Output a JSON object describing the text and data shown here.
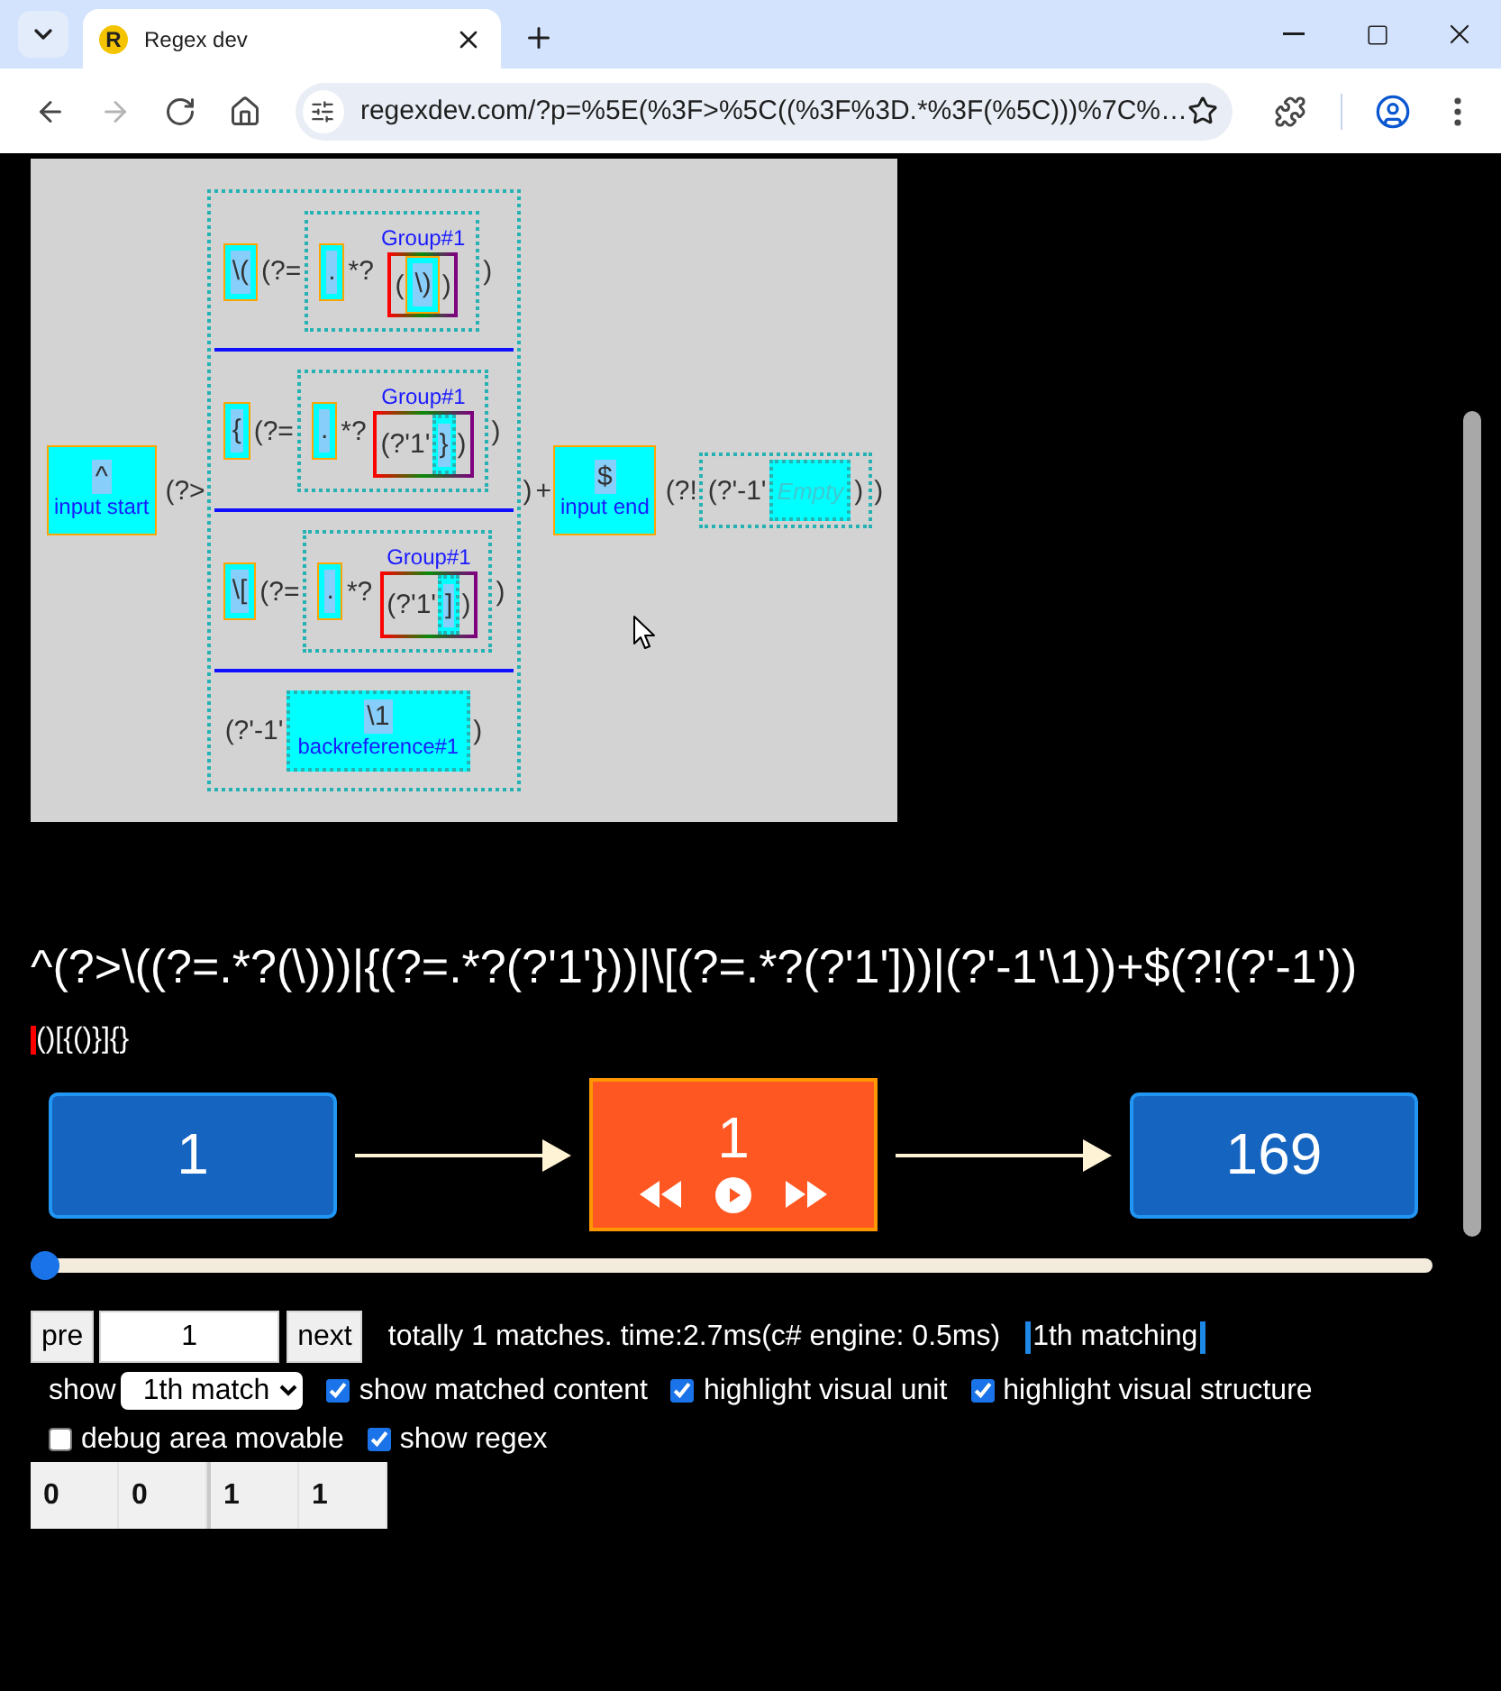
{
  "browser": {
    "tabs": [
      {
        "title": "Regex dev",
        "favicon": "R",
        "selected": true
      }
    ],
    "nav": [
      {
        "kind": "back",
        "disabled": false
      },
      {
        "kind": "forward",
        "disabled": true
      },
      {
        "kind": "reload",
        "disabled": false
      },
      {
        "kind": "home",
        "disabled": false
      }
    ],
    "url": "regexdev.com/?p=%5E(%3F>%5C((%3F%3D.*%3F(%5C)))%7C%…"
  },
  "diagram": {
    "children": [
      {
        "kind": "anchor",
        "symbol": "^",
        "label": "input start"
      },
      {
        "kind": "text",
        "text": "(?>"
      },
      {
        "kind": "alternation",
        "alternatives": [
          {
            "children": [
              {
                "kind": "literal",
                "text": "\\("
              },
              {
                "kind": "text",
                "text": "(?="
              },
              {
                "kind": "box",
                "children": [
                  {
                    "kind": "literal",
                    "text": "."
                  },
                  {
                    "kind": "text",
                    "text": "*?"
                  },
                  {
                    "kind": "group",
                    "label": "Group#1",
                    "children": [
                      {
                        "kind": "text",
                        "text": "("
                      },
                      {
                        "kind": "literal",
                        "text": "\\)"
                      },
                      {
                        "kind": "text",
                        "text": ")"
                      }
                    ]
                  }
                ]
              },
              {
                "kind": "text",
                "text": ")"
              }
            ]
          },
          {
            "children": [
              {
                "kind": "literal",
                "text": "{"
              },
              {
                "kind": "text",
                "text": "(?="
              },
              {
                "kind": "box",
                "children": [
                  {
                    "kind": "literal",
                    "text": "."
                  },
                  {
                    "kind": "text",
                    "text": "*?"
                  },
                  {
                    "kind": "group",
                    "label": "Group#1",
                    "children": [
                      {
                        "kind": "text",
                        "text": "(?'1'"
                      },
                      {
                        "kind": "char",
                        "text": "}"
                      },
                      {
                        "kind": "text",
                        "text": ")"
                      }
                    ]
                  }
                ]
              },
              {
                "kind": "text",
                "text": ")"
              }
            ]
          },
          {
            "children": [
              {
                "kind": "literal",
                "text": "\\["
              },
              {
                "kind": "text",
                "text": "(?="
              },
              {
                "kind": "box",
                "children": [
                  {
                    "kind": "literal",
                    "text": "."
                  },
                  {
                    "kind": "text",
                    "text": "*?"
                  },
                  {
                    "kind": "group",
                    "label": "Group#1",
                    "children": [
                      {
                        "kind": "text",
                        "text": "(?'1'"
                      },
                      {
                        "kind": "char",
                        "text": "]"
                      },
                      {
                        "kind": "text",
                        "text": ")"
                      }
                    ]
                  }
                ]
              },
              {
                "kind": "text",
                "text": ")"
              }
            ]
          },
          {
            "children": [
              {
                "kind": "text",
                "text": "(?'-1'"
              },
              {
                "kind": "backref",
                "symbol": "\\1",
                "label": "backreference#1"
              },
              {
                "kind": "text",
                "text": ")"
              }
            ]
          }
        ]
      },
      {
        "kind": "text",
        "text": ")"
      },
      {
        "kind": "text",
        "text": "+"
      },
      {
        "kind": "anchor",
        "symbol": "$",
        "label": "input end"
      },
      {
        "kind": "text",
        "text": "(?!"
      },
      {
        "kind": "box",
        "children": [
          {
            "kind": "text",
            "text": "(?'-1'"
          },
          {
            "kind": "empty",
            "text": "Empty"
          },
          {
            "kind": "text",
            "text": ")"
          }
        ]
      },
      {
        "kind": "text",
        "text": ")"
      }
    ]
  },
  "regex": "^(?>\\((?=.*?(\\)))|{(?=.*?(?'1'}))|\\[(?=.*?(?'1']))|(?'-1'\\1))+$(?!(?'-1'))",
  "test_string": "()[{()}]{}",
  "steps": [
    {
      "kind": "bound",
      "value": "1"
    },
    {
      "kind": "current",
      "value": "1"
    },
    {
      "kind": "bound",
      "value": "169"
    }
  ],
  "slider": {
    "level": 0
  },
  "pager": {
    "previous": "pre",
    "value": "1",
    "next": "next",
    "summary": "totally 1 matches. time:2.7ms(c# engine: 0.5ms)",
    "matching": "1th matching"
  },
  "options": [
    {
      "kind": "select",
      "label": "show",
      "value": "1th match"
    },
    {
      "kind": "checkbox",
      "label": "show matched content",
      "checked": true
    },
    {
      "kind": "checkbox",
      "label": "highlight visual unit",
      "checked": true
    },
    {
      "kind": "checkbox",
      "label": "highlight visual structure",
      "checked": true
    },
    {
      "kind": "checkbox",
      "label": "debug area movable",
      "checked": false
    },
    {
      "kind": "checkbox",
      "label": "show regex",
      "checked": true
    }
  ],
  "index_groups": [
    [
      "0",
      "0"
    ],
    [
      "1",
      "1"
    ]
  ]
}
